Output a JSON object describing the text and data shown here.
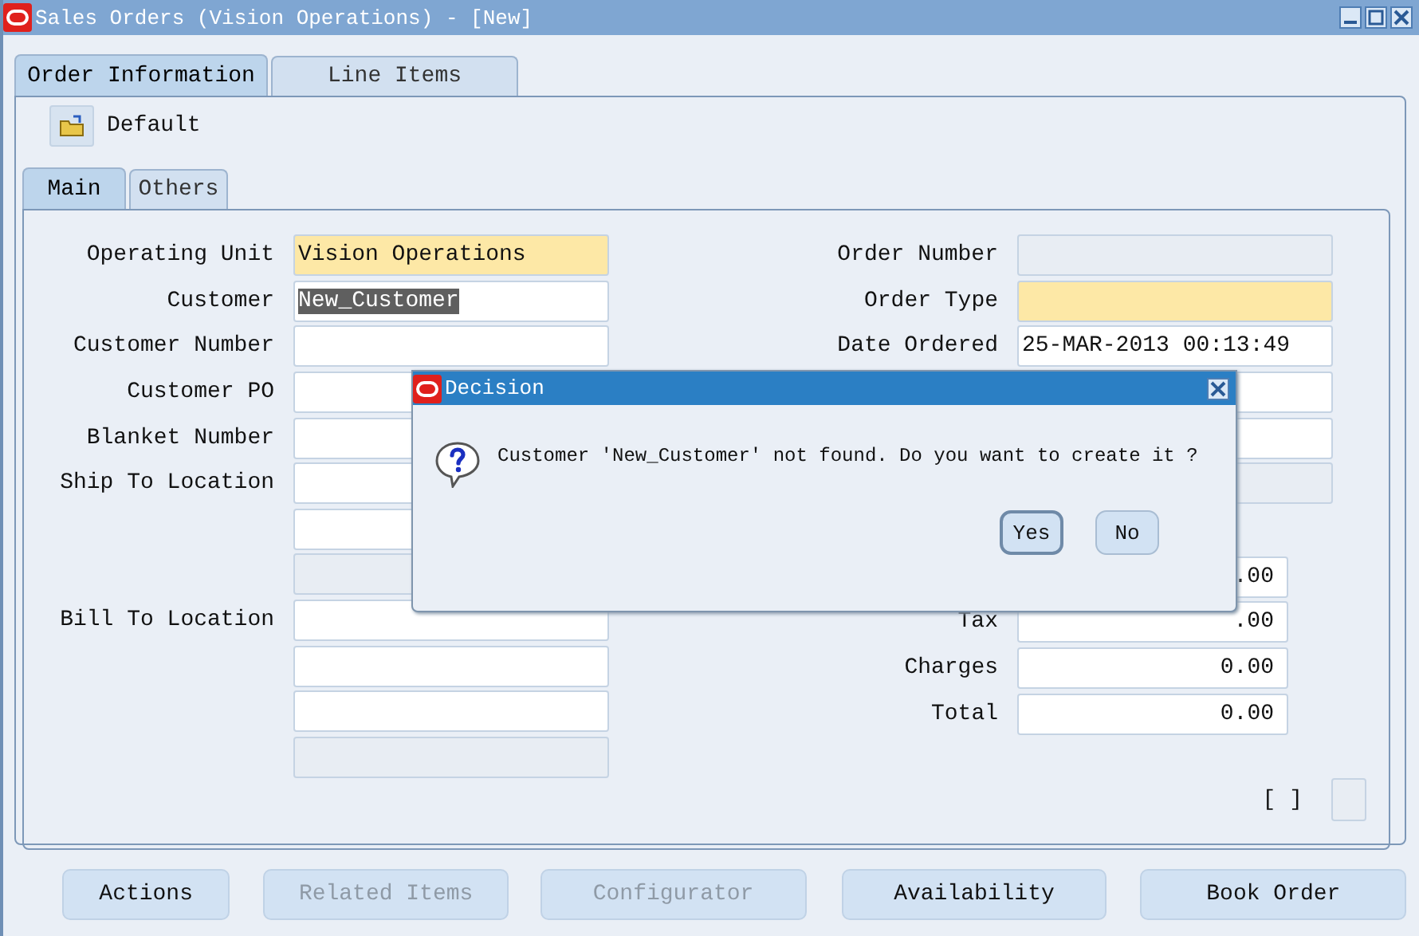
{
  "window": {
    "title": "Sales Orders (Vision Operations) - [New]"
  },
  "tabs": [
    {
      "label": "Order Information",
      "selected": true
    },
    {
      "label": "Line Items",
      "selected": false
    }
  ],
  "folder": {
    "label": "Default"
  },
  "subtabs": [
    {
      "label": "Main",
      "selected": true
    },
    {
      "label": "Others",
      "selected": false
    }
  ],
  "left_fields": [
    {
      "label": "Operating Unit",
      "kind": "required",
      "value": "Vision Operations"
    },
    {
      "label": "Customer",
      "kind": "text",
      "value": "New_Customer",
      "highlighted": true
    },
    {
      "label": "Customer Number",
      "kind": "text"
    },
    {
      "label": "Customer PO",
      "kind": "text"
    },
    {
      "label": "Blanket Number",
      "kind": "text"
    },
    {
      "label": "Ship To Location",
      "kind": "text"
    },
    {
      "kind": "text"
    },
    {
      "kind": "readonly"
    },
    {
      "label": "Bill To Location",
      "kind": "text"
    },
    {
      "kind": "text"
    },
    {
      "kind": "text"
    },
    {
      "kind": "readonly"
    }
  ],
  "right_fields": [
    {
      "label": "Order Number",
      "kind": "readonly"
    },
    {
      "label": "Order Type",
      "kind": "required"
    },
    {
      "label": "Date Ordered",
      "kind": "text",
      "value": "25-MAR-2013 00:13:49"
    },
    {
      "kind": "text"
    },
    {
      "kind": "text"
    },
    {
      "kind": "readonly"
    }
  ],
  "totals": [
    {
      "value": ".00"
    },
    {
      "label": "Tax",
      "value": ".00"
    },
    {
      "label": "Charges",
      "value": "0.00"
    },
    {
      "label": "Total",
      "value": "0.00"
    }
  ],
  "bracket": "[ ]",
  "buttons": [
    {
      "label": "Actions",
      "disabled": false
    },
    {
      "label": "Related Items",
      "disabled": true
    },
    {
      "label": "Configurator",
      "disabled": true
    },
    {
      "label": "Availability",
      "disabled": false
    },
    {
      "label": "Book Order",
      "disabled": false
    }
  ],
  "dialog": {
    "title": "Decision",
    "message": "Customer 'New_Customer' not  found. Do you want to create it ?",
    "buttons": [
      {
        "label": "Yes",
        "selected": true
      },
      {
        "label": "No",
        "selected": false
      }
    ]
  }
}
